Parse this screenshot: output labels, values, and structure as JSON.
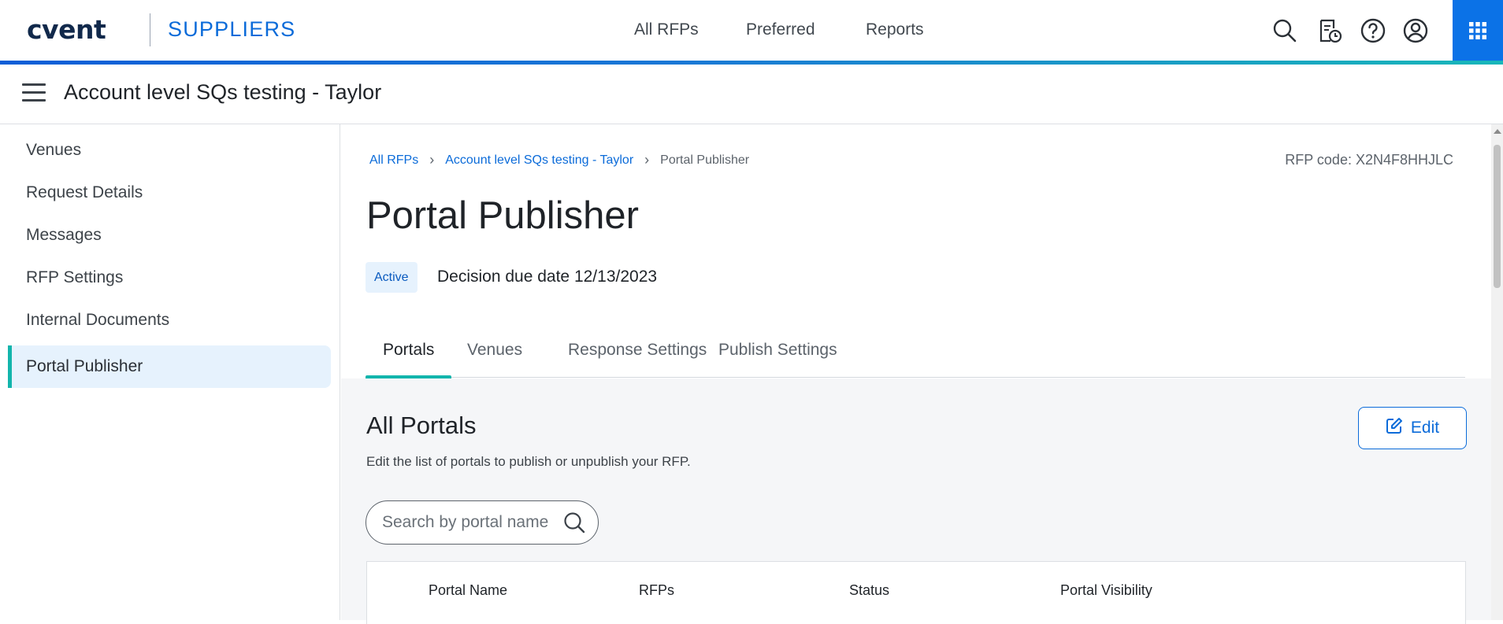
{
  "app": {
    "logo": "cvent",
    "brand": "SUPPLIERS",
    "nav": [
      "All RFPs",
      "Preferred",
      "Reports"
    ],
    "icons": [
      "search-icon",
      "rfp-history-icon",
      "help-icon",
      "account-icon",
      "apps-grid-icon"
    ],
    "accent_color": "#0b72e7",
    "teal_color": "#12b5ac"
  },
  "titlebar": {
    "title": "Account level SQs testing - Taylor"
  },
  "sidebar": {
    "items": [
      {
        "label": "Venues"
      },
      {
        "label": "Request Details"
      },
      {
        "label": "Messages"
      },
      {
        "label": "RFP Settings"
      },
      {
        "label": "Internal Documents"
      },
      {
        "label": "Portal Publisher",
        "active": true
      }
    ]
  },
  "main": {
    "breadcrumb": [
      "All RFPs",
      "Account level SQs testing - Taylor",
      "Portal Publisher"
    ],
    "rfp_code": "RFP code: X2N4F8HHJLC",
    "page_title": "Portal Publisher",
    "status": "Active",
    "due_date": "Decision due date 12/13/2023",
    "tabs": [
      {
        "label": "Portals",
        "active": true
      },
      {
        "label": "Venues"
      },
      {
        "label": "Response Settings"
      },
      {
        "label": "Publish Settings"
      }
    ],
    "panel": {
      "title": "All Portals",
      "description": "Edit the list of portals to publish or unpublish your RFP.",
      "edit_label": "Edit",
      "search_placeholder": "Search by portal name",
      "columns": [
        "Portal Name",
        "RFPs",
        "Status",
        "Portal Visibility"
      ]
    }
  }
}
